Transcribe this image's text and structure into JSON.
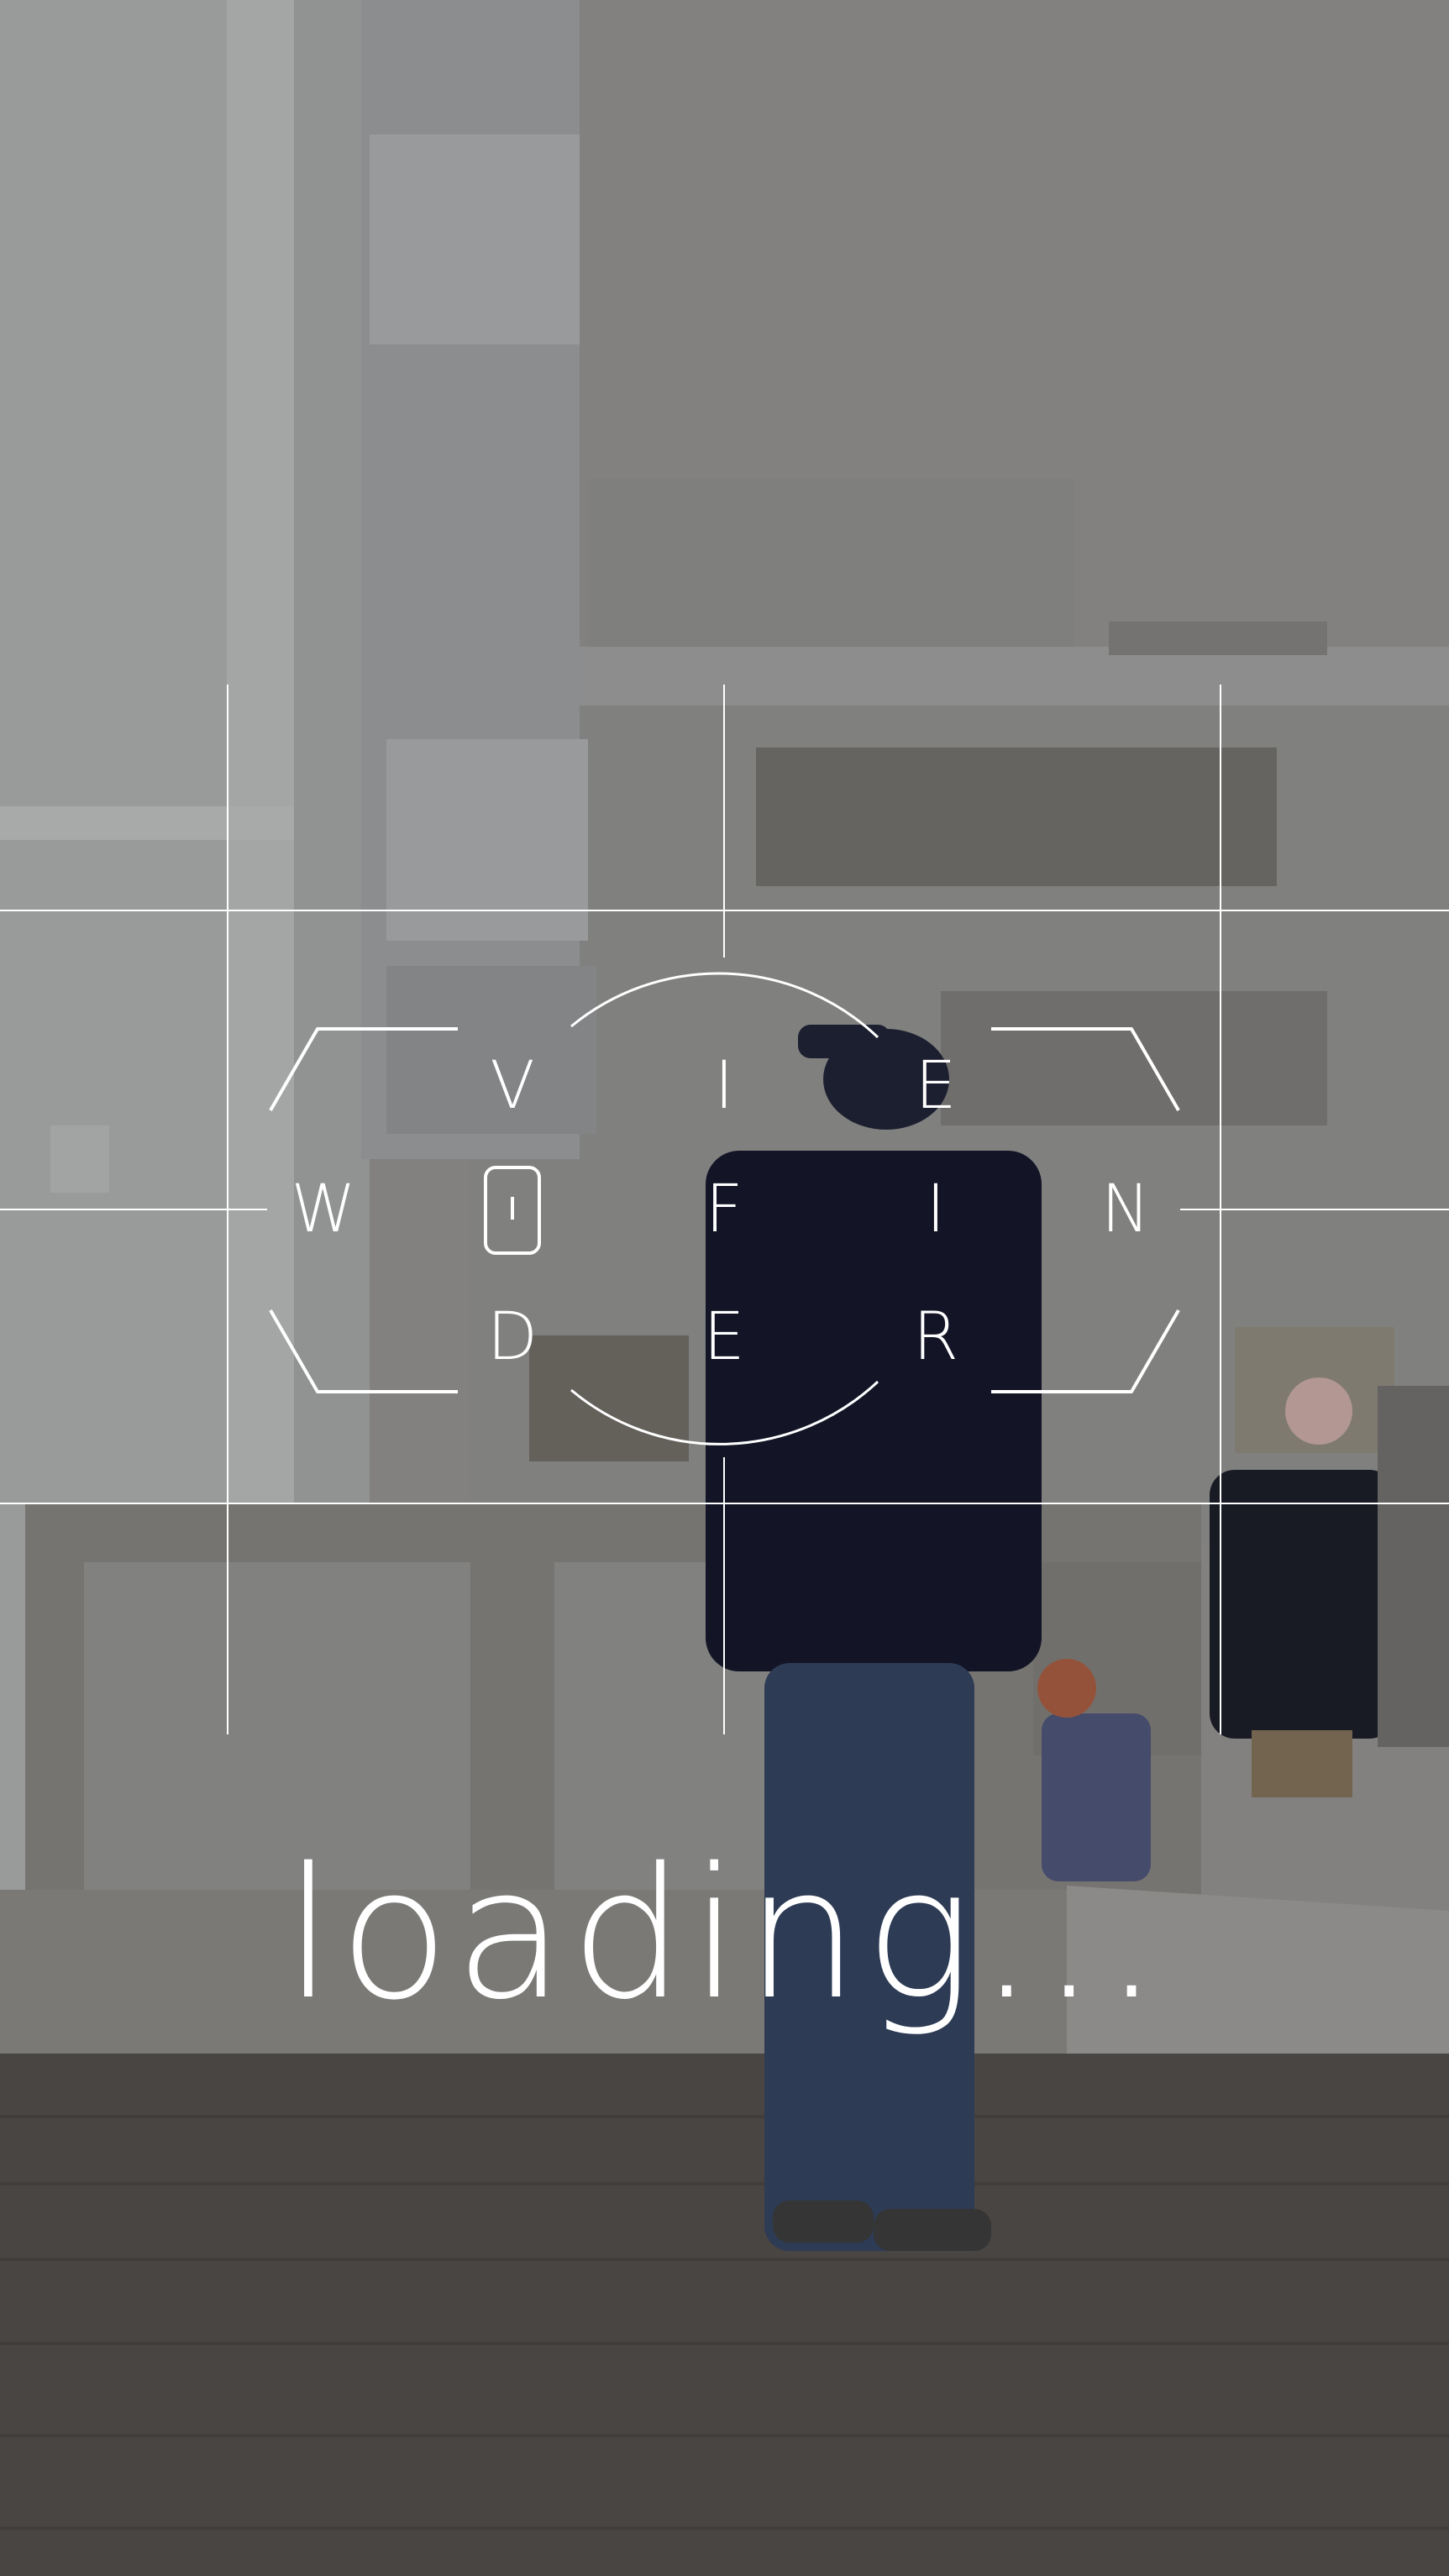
{
  "logo": {
    "letters": [
      "V",
      "I",
      "E",
      "W",
      "F",
      "I",
      "N",
      "D",
      "E",
      "R"
    ]
  },
  "status": {
    "loading_text": "loading..."
  },
  "background": {
    "description_icon": "photo-man-on-phone-icon"
  },
  "colors": {
    "overlay_line": "#ffffff",
    "sky": "#8c8a88",
    "deck": "#4e4a48"
  }
}
